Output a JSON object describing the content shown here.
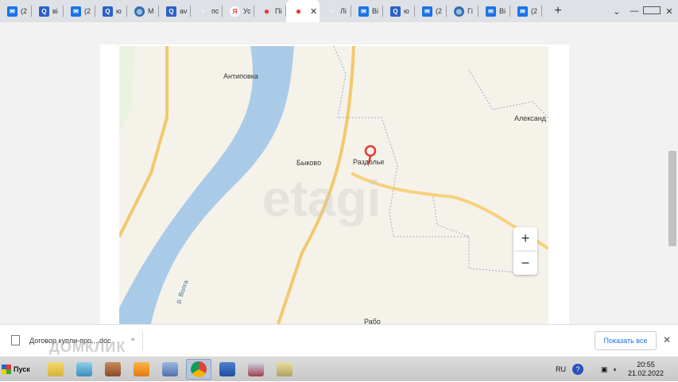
{
  "tabs": [
    {
      "icon": "mail-icon",
      "label": "(2"
    },
    {
      "icon": "search-icon",
      "label": "вi"
    },
    {
      "icon": "mail-icon",
      "label": "(2"
    },
    {
      "icon": "search-icon",
      "label": "ю"
    },
    {
      "icon": "ring-icon",
      "label": "M"
    },
    {
      "icon": "search-icon",
      "label": "av"
    },
    {
      "icon": "dots-icon",
      "label": "пс"
    },
    {
      "icon": "yandex-icon",
      "label": "Ус"
    },
    {
      "icon": "pin-icon",
      "label": "Пі"
    },
    {
      "icon": "pin-icon",
      "label": "",
      "active": true
    },
    {
      "icon": "dots-icon",
      "label": "Лі"
    },
    {
      "icon": "mail-icon",
      "label": "Ві"
    },
    {
      "icon": "search-icon",
      "label": "ю"
    },
    {
      "icon": "mail-icon",
      "label": "(2"
    },
    {
      "icon": "ring-icon",
      "label": "Гі"
    },
    {
      "icon": "mail-icon",
      "label": "Ві"
    },
    {
      "icon": "mail-icon",
      "label": "(2"
    }
  ],
  "tab_close": "✕",
  "new_tab": "+",
  "map": {
    "labels": {
      "antipovka": "Антиповка",
      "aleksandr": "Александ",
      "bykovo": "Быково",
      "razdolye": "Раздолье",
      "river": "р. Волга",
      "bottom": "Рабо"
    },
    "watermark": "etagi",
    "zoom_in": "+",
    "zoom_out": "−"
  },
  "downloads": {
    "file_name": "Договор купли-про....doc",
    "chevron": "^",
    "show_all": "Показать все",
    "close": "✕",
    "watermark": "ДОМКЛИК"
  },
  "taskbar": {
    "start_label": "Пуск",
    "lang": "RU",
    "help": "?",
    "time": "20:55",
    "date": "21.02.2022"
  },
  "colors": {
    "river": "#aacbe8",
    "road": "#f7d27d",
    "marker": "#e53935"
  }
}
